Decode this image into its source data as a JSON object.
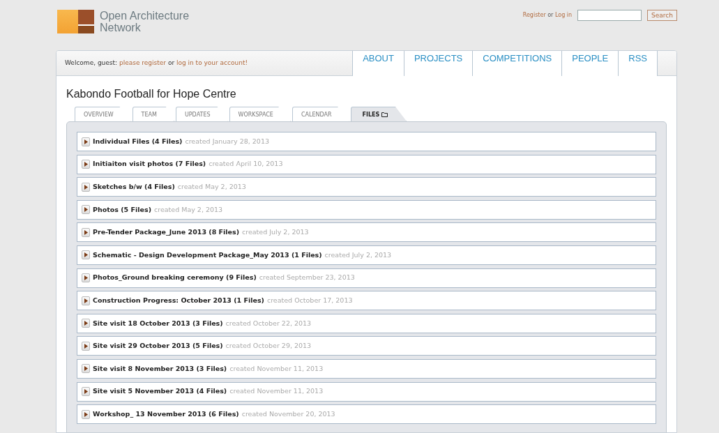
{
  "header": {
    "logo_lines": [
      "Open Architecture",
      "Network"
    ],
    "auth": {
      "register": "Register",
      "separator": "or",
      "login": "Log in"
    },
    "search": {
      "button": "Search"
    }
  },
  "welcome": {
    "greeting": "Welcome, guest:",
    "register_link": "please register",
    "separator": "or",
    "login_link": "log in to your account!"
  },
  "nav_tabs": [
    {
      "label": "ABOUT",
      "selected": false
    },
    {
      "label": "PROJECTS",
      "selected": false
    },
    {
      "label": "COMPETITIONS",
      "selected": false
    },
    {
      "label": "PEOPLE",
      "selected": false
    },
    {
      "label": "RSS",
      "selected": false
    }
  ],
  "project_title": "Kabondo Football for Hope Centre",
  "sub_tabs": [
    {
      "label": "OVERVIEW",
      "selected": false
    },
    {
      "label": "TEAM",
      "selected": false
    },
    {
      "label": "UPDATES",
      "selected": false
    },
    {
      "label": "WORKSPACE",
      "selected": false
    },
    {
      "label": "CALENDAR",
      "selected": false
    },
    {
      "label": "FILES",
      "selected": true
    }
  ],
  "folders": [
    {
      "name": "Individual Files (4 Files)",
      "created": "created January 28, 2013",
      "expanded": false
    },
    {
      "name": "Initiaiton visit photos (7 Files)",
      "created": "created April 10, 2013",
      "expanded": false
    },
    {
      "name": "Sketches b/w (4 Files)",
      "created": "created May 2, 2013",
      "expanded": false
    },
    {
      "name": "Photos (5 Files)",
      "created": "created May 2, 2013",
      "expanded": false
    },
    {
      "name": "Pre-Tender Package_June 2013 (8 Files)",
      "created": "created July 2, 2013",
      "expanded": false
    },
    {
      "name": "Schematic - Design Development Package_May 2013 (1 Files)",
      "created": "created July 2, 2013",
      "expanded": false
    },
    {
      "name": "Photos_Ground breaking ceremony (9 Files)",
      "created": "created September 23, 2013",
      "expanded": false
    },
    {
      "name": "Construction Progress: October 2013 (1 Files)",
      "created": "created October 17, 2013",
      "expanded": false
    },
    {
      "name": "Site visit 18 October 2013 (3 Files)",
      "created": "created October 22, 2013",
      "expanded": false
    },
    {
      "name": "Site visit 29 October 2013 (5 Files)",
      "created": "created October 29, 2013",
      "expanded": false
    },
    {
      "name": "Site visit 8 November 2013 (3 Files)",
      "created": "created November 11, 2013",
      "expanded": false
    },
    {
      "name": "Site visit 5 November 2013 (4 Files)",
      "created": "created November 11, 2013",
      "expanded": false
    },
    {
      "name": "Workshop_ 13 November 2013 (6 Files)",
      "created": "created November 20, 2013",
      "expanded": false
    }
  ]
}
